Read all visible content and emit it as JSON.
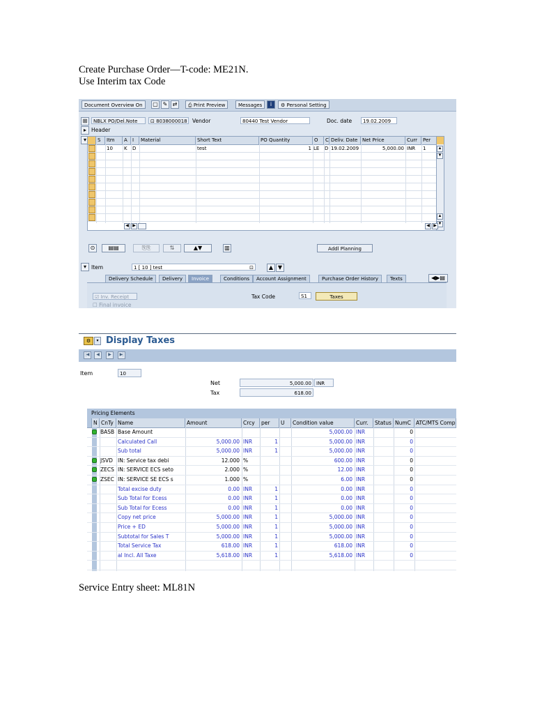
{
  "doc": {
    "line1": "Create Purchase Order—T-code: ME21N.",
    "line2": "Use Interim tax Code",
    "line3": "Service Entry sheet: ML81N"
  },
  "po": {
    "toolbar": {
      "doc_overview": "Document Overview On",
      "print_preview": "Print Preview",
      "messages": "Messages",
      "personal_setting": "Personal Setting"
    },
    "header": {
      "doc_type": "NBLX PO/Del.Note",
      "doc_number": "8038000018",
      "vendor_label": "Vendor",
      "vendor_value": "80440 Test Vendor",
      "doc_date_label": "Doc. date",
      "doc_date_value": "19.02.2009",
      "header_label": "Header"
    },
    "grid": {
      "columns": [
        "S",
        "Itm",
        "A",
        "I",
        "Material",
        "Short Text",
        "PO Quantity",
        "O",
        "C",
        "Deliv. Date",
        "Net Price",
        "Curr",
        "Per"
      ],
      "row": {
        "itm": "10",
        "a": "K",
        "i": "D",
        "short_text": "test",
        "po_qty": "1",
        "oun": "LE",
        "c": "D",
        "deliv_date": "19.02.2009",
        "net_price": "5,000.00",
        "curr": "INR",
        "per": "1"
      }
    },
    "addl_planning": "Addl Planning",
    "item": {
      "label": "Item",
      "value": "1 [ 10 ] test"
    },
    "tabs": [
      "Delivery Schedule",
      "Delivery",
      "Invoice",
      "Conditions",
      "Account Assignment",
      "Purchase Order History",
      "Texts"
    ],
    "active_tab": "Invoice",
    "invoice": {
      "inv_receipt": "Inv. Receipt",
      "final_invoice": "Final invoice",
      "tax_code_label": "Tax Code",
      "tax_code_value": "S1",
      "taxes_button": "Taxes"
    }
  },
  "taxes": {
    "title": "Display Taxes",
    "item_label": "Item",
    "item_value": "10",
    "net_label": "Net",
    "net_value": "5,000.00",
    "net_curr": "INR",
    "tax_label": "Tax",
    "tax_value": "618.00",
    "pricing_title": "Pricing Elements",
    "columns": [
      "N",
      "CnTy",
      "Name",
      "Amount",
      "Crcy",
      "per",
      "U",
      "Condition value",
      "Curr.",
      "Status",
      "NumC",
      "ATC/MTS Comp"
    ],
    "rows": [
      {
        "light": true,
        "cnty": "BASB",
        "name": "Base Amount",
        "amount": "",
        "crcy": "",
        "per": "",
        "cond": "5,000.00",
        "curr": "INR",
        "numc": "0",
        "blue": false
      },
      {
        "light": false,
        "cnty": "",
        "name": "Calculated Call",
        "amount": "5,000.00",
        "crcy": "INR",
        "per": "1",
        "cond": "5,000.00",
        "curr": "INR",
        "numc": "0",
        "blue": true
      },
      {
        "light": false,
        "cnty": "",
        "name": "Sub total",
        "amount": "5,000.00",
        "crcy": "INR",
        "per": "1",
        "cond": "5,000.00",
        "curr": "INR",
        "numc": "0",
        "blue": true
      },
      {
        "light": true,
        "cnty": "JSVD",
        "name": "IN: Service tax debi",
        "amount": "12.000",
        "crcy": "%",
        "per": "",
        "cond": "600.00",
        "curr": "INR",
        "numc": "0",
        "blue": false
      },
      {
        "light": true,
        "cnty": "ZECS",
        "name": "IN: SERVICE ECS seto",
        "amount": "2.000",
        "crcy": "%",
        "per": "",
        "cond": "12.00",
        "curr": "INR",
        "numc": "0",
        "blue": false
      },
      {
        "light": true,
        "cnty": "ZSEC",
        "name": "IN: SERVICE SE ECS s",
        "amount": "1.000",
        "crcy": "%",
        "per": "",
        "cond": "6.00",
        "curr": "INR",
        "numc": "0",
        "blue": false
      },
      {
        "light": false,
        "cnty": "",
        "name": "Total excise duty",
        "amount": "0.00",
        "crcy": "INR",
        "per": "1",
        "cond": "0.00",
        "curr": "INR",
        "numc": "0",
        "blue": true
      },
      {
        "light": false,
        "cnty": "",
        "name": "Sub Total for Ecess",
        "amount": "0.00",
        "crcy": "INR",
        "per": "1",
        "cond": "0.00",
        "curr": "INR",
        "numc": "0",
        "blue": true
      },
      {
        "light": false,
        "cnty": "",
        "name": "Sub Total for Ecess",
        "amount": "0.00",
        "crcy": "INR",
        "per": "1",
        "cond": "0.00",
        "curr": "INR",
        "numc": "0",
        "blue": true
      },
      {
        "light": false,
        "cnty": "",
        "name": "Copy net price",
        "amount": "5,000.00",
        "crcy": "INR",
        "per": "1",
        "cond": "5,000.00",
        "curr": "INR",
        "numc": "0",
        "blue": true
      },
      {
        "light": false,
        "cnty": "",
        "name": "Price + ED",
        "amount": "5,000.00",
        "crcy": "INR",
        "per": "1",
        "cond": "5,000.00",
        "curr": "INR",
        "numc": "0",
        "blue": true
      },
      {
        "light": false,
        "cnty": "",
        "name": "Subtotal for Sales T",
        "amount": "5,000.00",
        "crcy": "INR",
        "per": "1",
        "cond": "5,000.00",
        "curr": "INR",
        "numc": "0",
        "blue": true
      },
      {
        "light": false,
        "cnty": "",
        "name": "Total Service Tax",
        "amount": "618.00",
        "crcy": "INR",
        "per": "1",
        "cond": "618.00",
        "curr": "INR",
        "numc": "0",
        "blue": true
      },
      {
        "light": false,
        "cnty": "",
        "name": "al Incl. All Taxe",
        "amount": "5,618.00",
        "crcy": "INR",
        "per": "1",
        "cond": "5,618.00",
        "curr": "INR",
        "numc": "0",
        "blue": true
      },
      {
        "light": false,
        "cnty": "",
        "name": "",
        "amount": "",
        "crcy": "",
        "per": "",
        "cond": "",
        "curr": "",
        "numc": "",
        "blue": false
      }
    ]
  }
}
